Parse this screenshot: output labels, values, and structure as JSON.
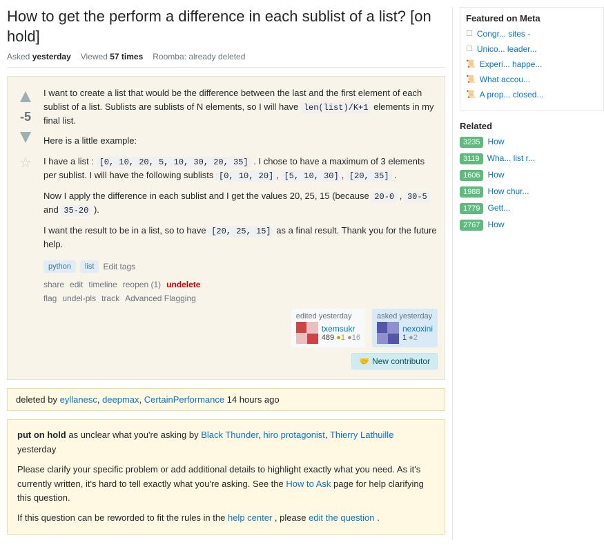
{
  "page": {
    "title": "How to get the perform a difference in each sublist of a list? [on hold]",
    "meta": {
      "asked_label": "Asked",
      "asked_value": "yesterday",
      "viewed_label": "Viewed",
      "viewed_value": "57 times",
      "roomba_label": "Roomba:",
      "roomba_value": "already deleted"
    }
  },
  "question": {
    "vote_count": "-5",
    "body_paragraphs": [
      "I want to create a list that would be the difference between the last and the first element of each sublist of a list. Sublists are sublists of N elements, so I will have len(list)/K+1 elements in my final list.",
      "Here is a little example:",
      "I have a list : [0, 10, 20, 5, 10, 30, 20, 35] . I chose to have a maximum of 3 elements per sublist. I will have the following sublists [0, 10, 20], [5, 10, 30], [20, 35] .",
      "Now I apply the difference in each sublist and I get the values 20, 25, 15 (because 20-0 , 30-5 and 35-20 ).",
      "I want the result to be in a list, so to have [20, 25, 15] as a final result. Thank you for the future help."
    ],
    "tags": [
      "python",
      "list"
    ],
    "edit_tags_label": "Edit tags",
    "actions": {
      "share": "share",
      "edit": "edit",
      "timeline": "timeline",
      "reopen": "reopen",
      "reopen_count": "(1)",
      "undelete": "undelete",
      "flag": "flag",
      "undel_pls": "undel-pls",
      "track": "track",
      "advanced_flagging": "Advanced Flagging"
    },
    "edited": {
      "label": "edited yesterday",
      "user": "txemsukr",
      "rep": "489",
      "gold": "1",
      "silver": "16"
    },
    "asked": {
      "label": "asked yesterday",
      "user": "nexoxini",
      "rep": "1",
      "gold": "2"
    },
    "new_contributor_label": "New contributor"
  },
  "deleted_notice": {
    "text": "deleted by",
    "deleters": "eyllanesc, deepmax, CertainPerformance",
    "time": "14 hours ago"
  },
  "on_hold": {
    "text1": "put on hold",
    "text2": " as unclear what you're asking by ",
    "users": "Black Thunder, hiro protagonist, Thierry Lathuille",
    "time": "yesterday",
    "p1": "Please clarify your specific problem or add additional details to highlight exactly what you need. As it's currently written, it's hard to tell exactly what you're asking. See the ",
    "how_to_ask": "How to Ask",
    "p1_end": " page for help clarifying this question.",
    "p2_start": "If this question can be reworded to fit the rules in the ",
    "help_center": "help center",
    "p2_middle": ", please ",
    "edit_question": "edit the question",
    "p2_end": "."
  },
  "sidebar": {
    "featured_title": "Featured on Meta",
    "featured_items": [
      {
        "icon": "checkbox",
        "text": "Congr... sites -"
      },
      {
        "icon": "checkbox",
        "text": "Unico... leader..."
      },
      {
        "icon": "scroll",
        "text": "Experi... happe..."
      },
      {
        "icon": "scroll",
        "text": "What accou..."
      },
      {
        "icon": "scroll",
        "text": "A prop... closed..."
      }
    ],
    "related_title": "Related",
    "related_items": [
      {
        "score": "3235",
        "text": "How"
      },
      {
        "score": "3119",
        "text": "Wha... list r..."
      },
      {
        "score": "1606",
        "text": "How"
      },
      {
        "score": "1988",
        "text": "How chur..."
      },
      {
        "score": "1779",
        "text": "Gett..."
      },
      {
        "score": "2767",
        "text": "How"
      }
    ]
  },
  "colors": {
    "accent": "#0077cc",
    "tag_bg": "#e1ecf4",
    "tag_text": "#39739d",
    "deleted_bg": "#fff8e2",
    "on_hold_bg": "#fff8e2",
    "new_contributor": "#d1ecf1",
    "related_score": "#5eba7d"
  }
}
